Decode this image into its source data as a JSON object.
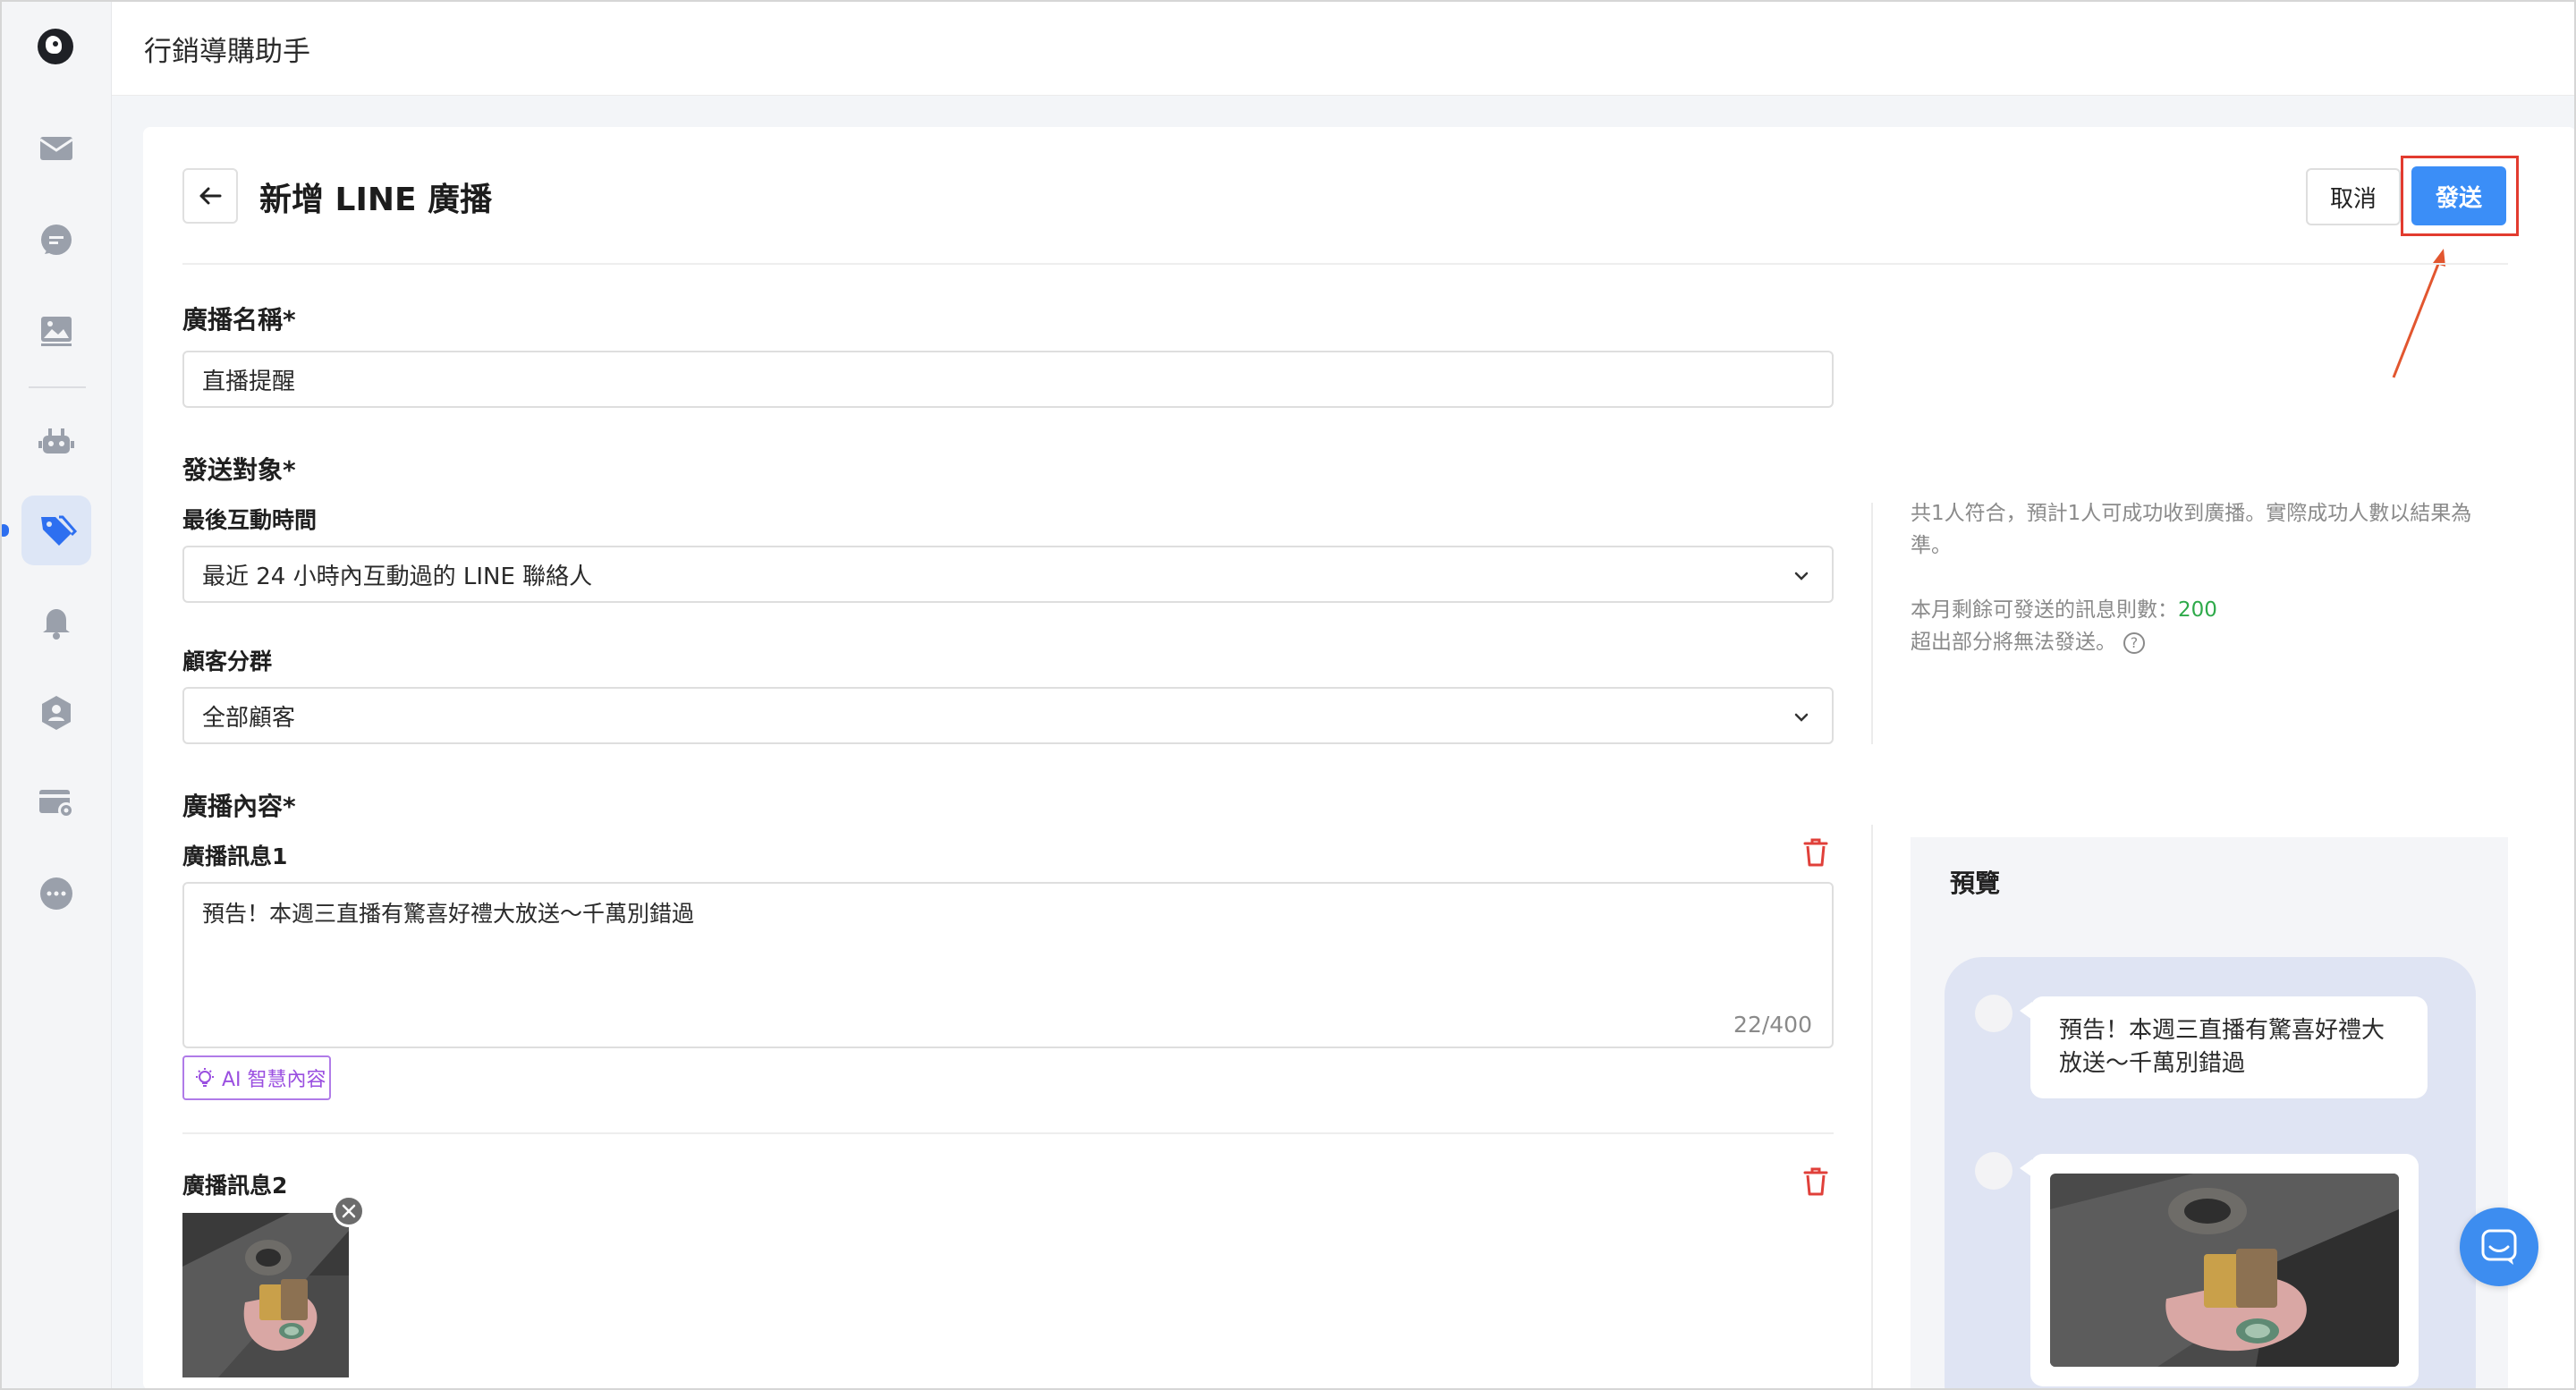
{
  "app": {
    "title": "行銷導購助手"
  },
  "sidebar": {
    "items": [
      {
        "icon": "mail-icon"
      },
      {
        "icon": "chat-icon"
      },
      {
        "icon": "image-icon"
      },
      {
        "icon": "bot-icon"
      },
      {
        "icon": "tag-icon",
        "active": true
      },
      {
        "icon": "bell-icon"
      },
      {
        "icon": "contacts-icon"
      },
      {
        "icon": "card-settings-icon"
      },
      {
        "icon": "more-icon"
      }
    ]
  },
  "header": {
    "title": "新增 LINE 廣播",
    "cancel_label": "取消",
    "send_label": "發送"
  },
  "form": {
    "name_label": "廣播名稱*",
    "name_value": "直播提醒",
    "target_label": "發送對象*",
    "last_interaction_label": "最後互動時間",
    "last_interaction_value": "最近 24 小時內互動過的 LINE 聯絡人",
    "segment_label": "顧客分群",
    "segment_value": "全部顧客",
    "content_label": "廣播內容*",
    "message1_label": "廣播訊息1",
    "message1_text": "預告！本週三直播有驚喜好禮大放送～千萬別錯過",
    "message1_counter": "22/400",
    "ai_button_label": "AI 智慧內容",
    "message2_label": "廣播訊息2"
  },
  "info": {
    "match_line1": "共1人符合，預計1人可成功收到廣播。實際成功人數以結果為",
    "match_line2": "準。",
    "quota_label": "本月剩餘可發送的訊息則數：",
    "quota_value": "200",
    "quota_note": "超出部分將無法發送。"
  },
  "preview": {
    "title": "預覽",
    "bubble_line1": "預告！本週三直播有驚喜好禮大",
    "bubble_line2": "放送～千萬別錯過"
  },
  "colors": {
    "primary": "#3b8ef7",
    "highlight": "#e23b2f",
    "ai_purple": "#9a4fe0",
    "quota_green": "#2eaa4a",
    "trash_red": "#e0403a"
  }
}
